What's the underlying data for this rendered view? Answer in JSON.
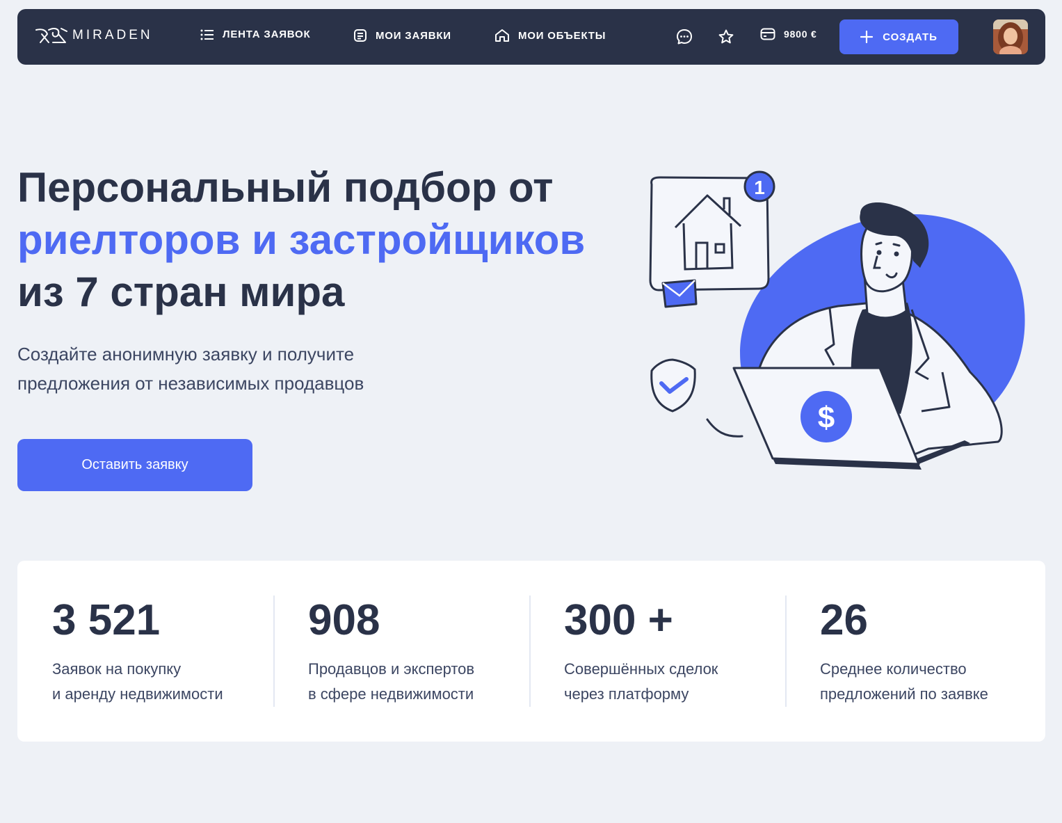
{
  "navbar": {
    "logo": "MIRADEN",
    "nav": [
      {
        "label": "ЛЕНТА ЗАЯВОК",
        "icon": "list-icon"
      },
      {
        "label": "МОИ ЗАЯВКИ",
        "icon": "document-icon"
      },
      {
        "label": "МОИ ОБЪЕКТЫ",
        "icon": "home-icon"
      }
    ],
    "icons": [
      "chat-icon",
      "star-icon",
      "wallet-icon",
      "plus-icon"
    ],
    "balance": "9800 €",
    "create_label": "СОЗДАТЬ"
  },
  "hero": {
    "title_line1": "Персональный подбор от",
    "title_accent": "риелторов и застройщиков",
    "title_line3": "из 7 стран мира",
    "subtitle_line1": "Создайте анонимную заявку и получите",
    "subtitle_line2": "предложения от независимых продавцов",
    "cta_label": "Оставить заявку",
    "notification_count": "1"
  },
  "stats": [
    {
      "value": "3 521",
      "label": "Заявок на покупку\nи аренду недвижимости"
    },
    {
      "value": "908",
      "label": "Продавцов и экспертов\nв сфере недвижимости"
    },
    {
      "value": "300 +",
      "label": "Совершённых сделок\nчерез платформу"
    },
    {
      "value": "26",
      "label": "Среднее количество\nпредложений по заявке"
    }
  ],
  "colors": {
    "navy": "#2A3248",
    "accent": "#4E6AF3",
    "background": "#EEF1F6",
    "card": "#FFFFFF"
  }
}
